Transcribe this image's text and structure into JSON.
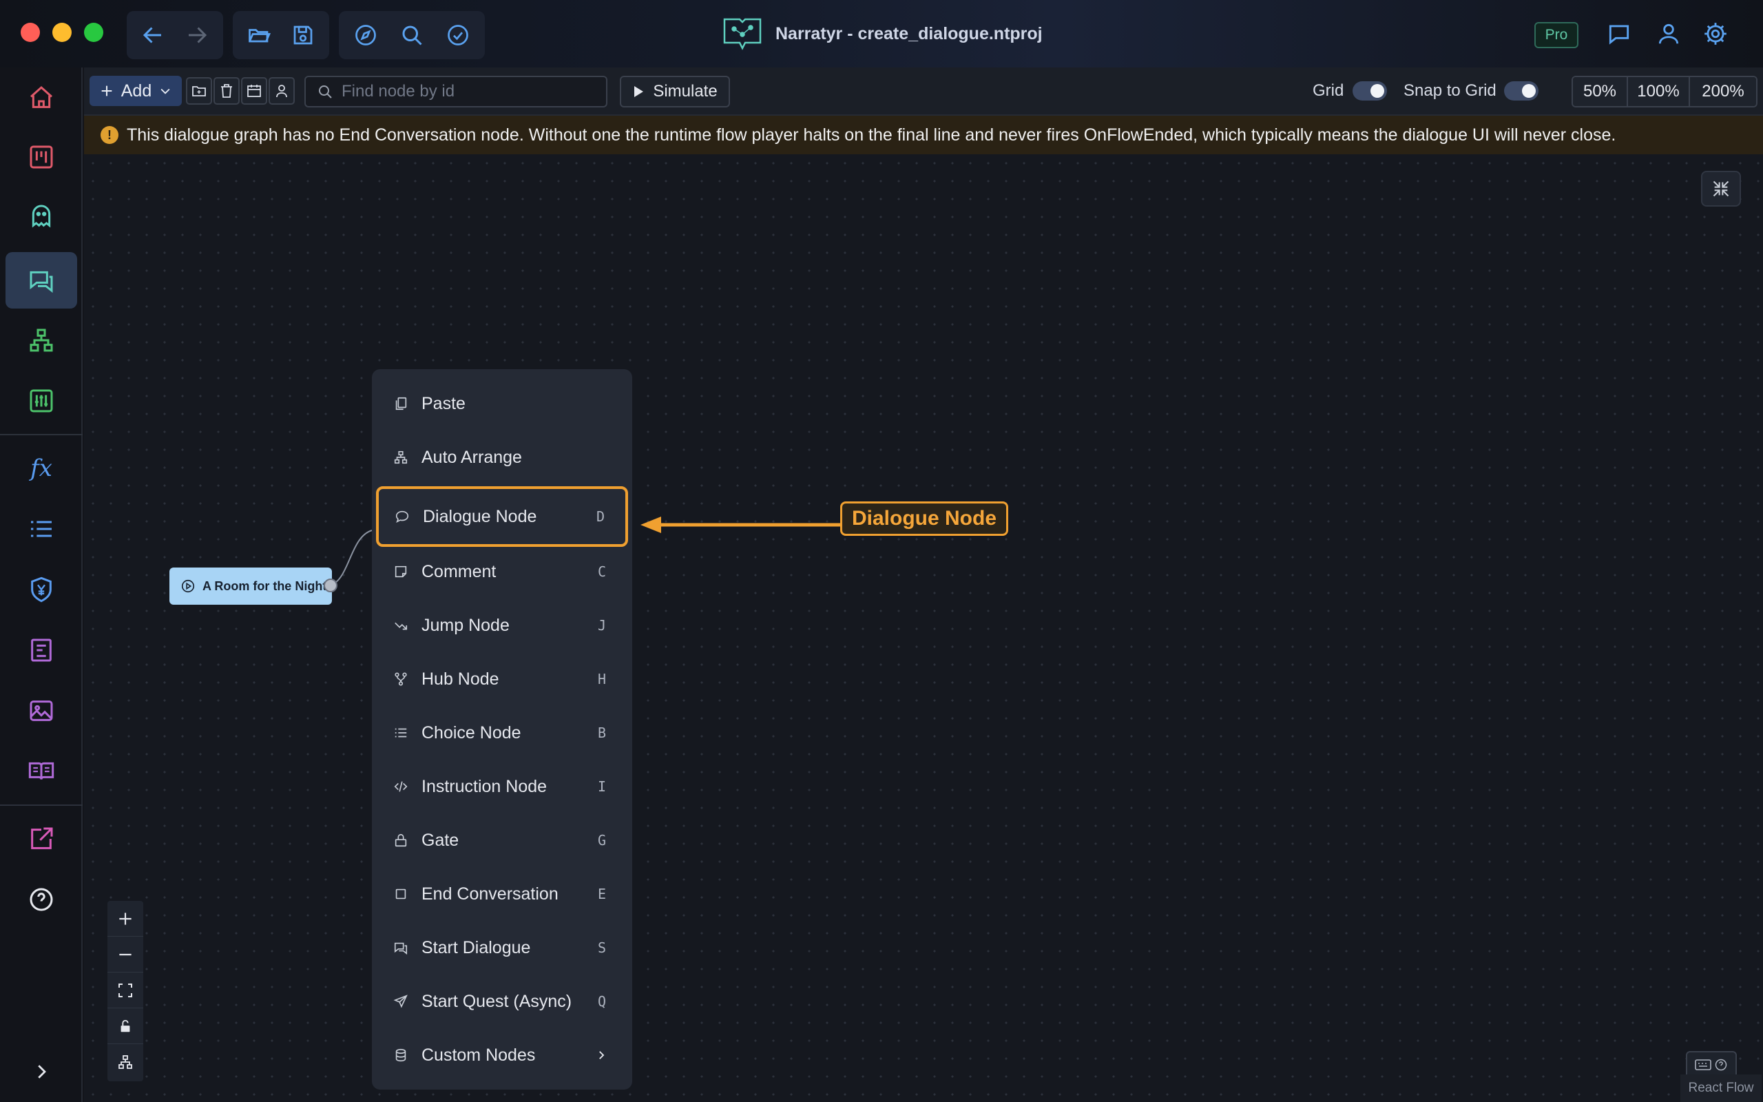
{
  "window": {
    "title": "Narratyr - create_dialogue.ntproj",
    "pro_badge": "Pro"
  },
  "titlebar": {
    "left_tools": [
      "back-icon",
      "forward-icon",
      "open-folder-icon",
      "save-icon",
      "compass-icon",
      "search-icon",
      "check-circle-icon"
    ],
    "right_tools": [
      "chat-bubbles-icon",
      "user-icon",
      "gear-icon"
    ]
  },
  "rail": {
    "items": [
      "home-icon",
      "board-icon",
      "ghost-icon",
      "dialogue-icon",
      "hierarchy-icon",
      "sliders-icon",
      "function-icon",
      "list-icon",
      "shield-yen-icon",
      "terminal-card-icon",
      "image-icon",
      "book-icon",
      "export-icon",
      "help-icon",
      "expand-icon"
    ],
    "active": "dialogue-icon",
    "function_label": "fx"
  },
  "toolbar": {
    "add_label": "Add",
    "search_placeholder": "Find node by id",
    "simulate_label": "Simulate",
    "grid_label": "Grid",
    "snap_label": "Snap to Grid",
    "zoom_levels": [
      "50%",
      "100%",
      "200%"
    ]
  },
  "warning": {
    "text": "This dialogue graph has no End Conversation node. Without one the runtime flow player halts on the final line and never fires OnFlowEnded, which typically means the dialogue UI will never close."
  },
  "canvas": {
    "start_node_label": "A Room for the Night",
    "attribution": "React Flow"
  },
  "context_menu": {
    "items": [
      {
        "label": "Paste",
        "shortcut": "",
        "icon": "paste-icon"
      },
      {
        "label": "Auto Arrange",
        "shortcut": "",
        "icon": "arrange-icon"
      },
      {
        "label": "Dialogue Node",
        "shortcut": "D",
        "icon": "speech-bubble-icon"
      },
      {
        "label": "Comment",
        "shortcut": "C",
        "icon": "comment-note-icon"
      },
      {
        "label": "Jump Node",
        "shortcut": "J",
        "icon": "jump-arrow-icon"
      },
      {
        "label": "Hub Node",
        "shortcut": "H",
        "icon": "hub-icon"
      },
      {
        "label": "Choice Node",
        "shortcut": "B",
        "icon": "list-icon"
      },
      {
        "label": "Instruction Node",
        "shortcut": "I",
        "icon": "code-icon"
      },
      {
        "label": "Gate",
        "shortcut": "G",
        "icon": "lock-icon"
      },
      {
        "label": "End Conversation",
        "shortcut": "E",
        "icon": "square-icon"
      },
      {
        "label": "Start Dialogue",
        "shortcut": "S",
        "icon": "chat-icon"
      },
      {
        "label": "Start Quest (Async)",
        "shortcut": "Q",
        "icon": "send-icon"
      },
      {
        "label": "Custom Nodes",
        "shortcut": "",
        "icon": "database-icon"
      }
    ]
  },
  "callout": {
    "label": "Dialogue Node",
    "color": "#f0a030"
  }
}
